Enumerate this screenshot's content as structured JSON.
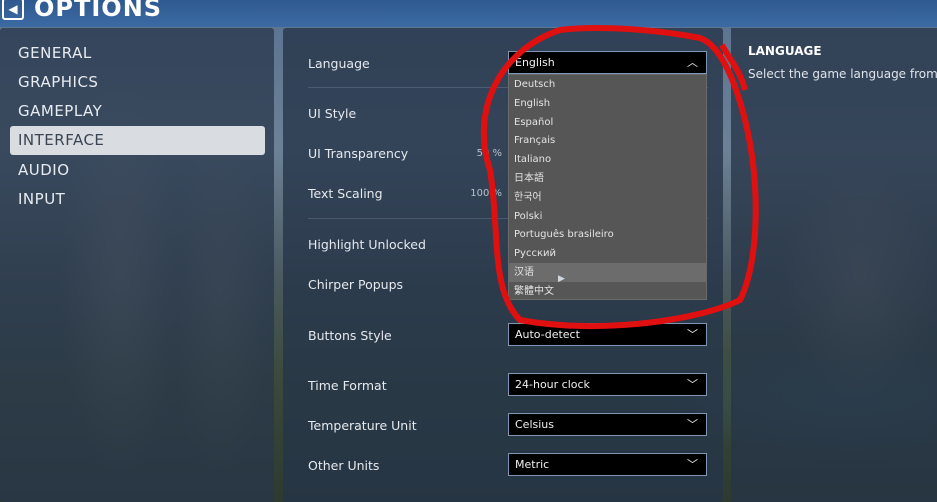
{
  "header": {
    "title": "OPTIONS",
    "back_icon": "back-arrow-icon"
  },
  "sidebar": {
    "items": [
      {
        "label": "GENERAL"
      },
      {
        "label": "GRAPHICS"
      },
      {
        "label": "GAMEPLAY"
      },
      {
        "label": "INTERFACE",
        "selected": true
      },
      {
        "label": "AUDIO"
      },
      {
        "label": "INPUT"
      }
    ]
  },
  "settings": {
    "language": {
      "label": "Language",
      "value": "English"
    },
    "ui_style": {
      "label": "UI Style"
    },
    "ui_transparency": {
      "label": "UI Transparency",
      "value": "50 %"
    },
    "text_scaling": {
      "label": "Text Scaling",
      "value": "100 %"
    },
    "highlight_unlocked": {
      "label": "Highlight Unlocked"
    },
    "chirper_popups": {
      "label": "Chirper Popups"
    },
    "buttons_style": {
      "label": "Buttons Style",
      "value": "Auto-detect"
    },
    "time_format": {
      "label": "Time Format",
      "value": "24-hour clock"
    },
    "temperature_unit": {
      "label": "Temperature Unit",
      "value": "Celsius"
    },
    "other_units": {
      "label": "Other Units",
      "value": "Metric"
    }
  },
  "language_options": [
    "Deutsch",
    "English",
    "Español",
    "Français",
    "Italiano",
    "日本語",
    "한국어",
    "Polski",
    "Português brasileiro",
    "Русский",
    "汉语",
    "繁體中文"
  ],
  "hovered_option": "汉语",
  "info": {
    "title": "LANGUAGE",
    "description": "Select the game language from the"
  },
  "colors": {
    "annotation": "#e01010",
    "accent": "#3c6aa3",
    "selected_nav": "#d9dde2"
  }
}
